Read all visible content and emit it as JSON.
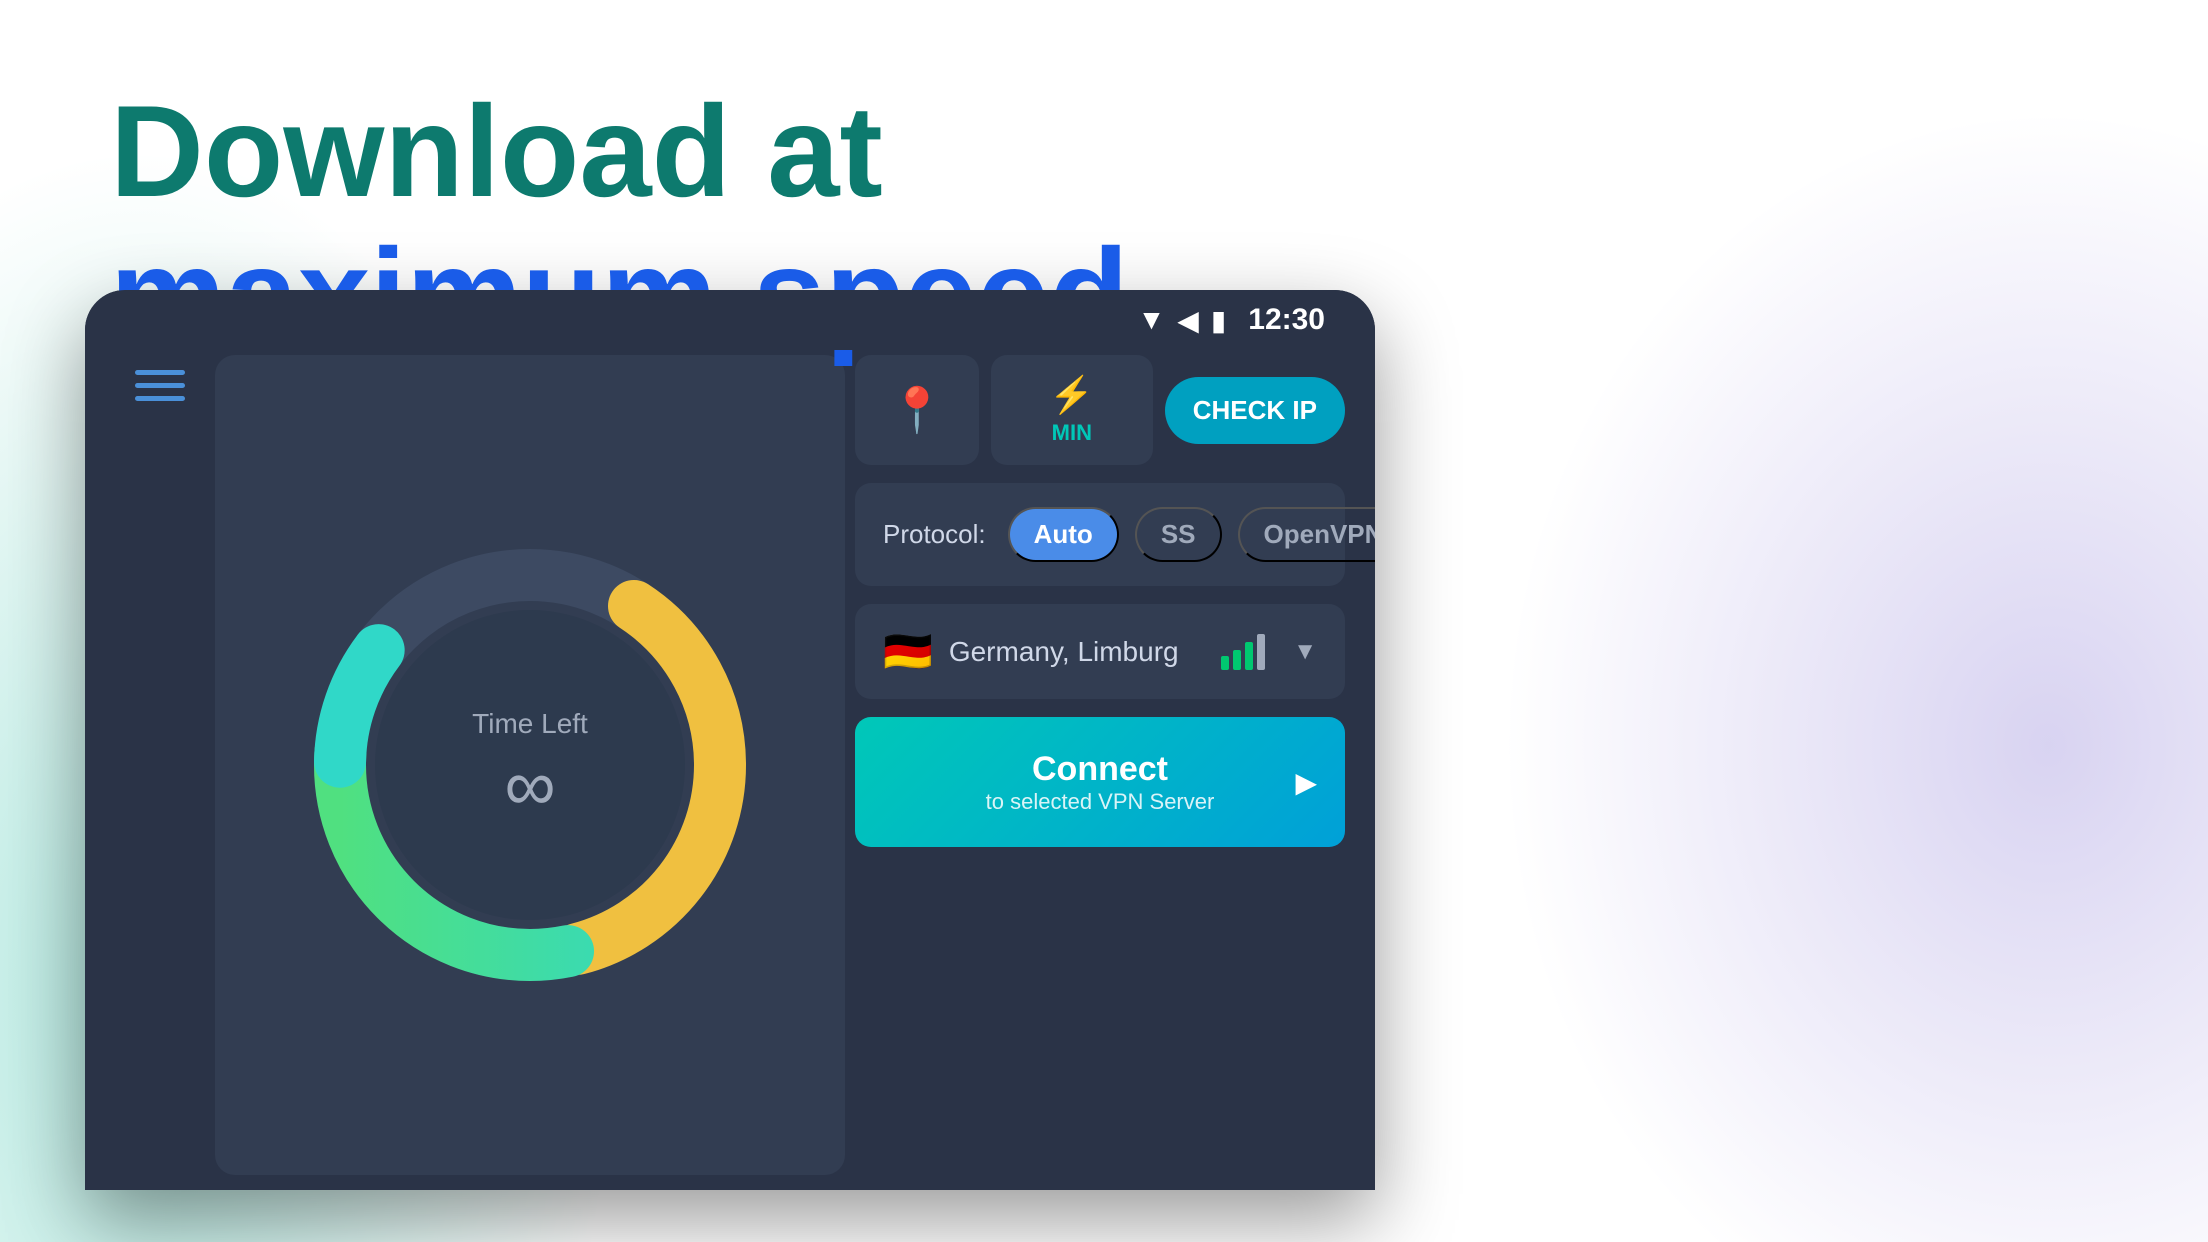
{
  "headline": {
    "line1": "Download at",
    "line2": "maximum speed"
  },
  "statusBar": {
    "time": "12:30"
  },
  "donut": {
    "timeLeftLabel": "Time Left",
    "infinitySymbol": "∞"
  },
  "topButtons": {
    "minLabel": "MIN",
    "checkIpLabel": "CHECK IP"
  },
  "protocol": {
    "label": "Protocol:",
    "options": [
      "Auto",
      "SS",
      "OpenVPN"
    ],
    "activeOption": "Auto"
  },
  "server": {
    "flag": "🇩🇪",
    "name": "Germany, Limburg"
  },
  "connect": {
    "title": "Connect",
    "subtitle": "to selected VPN Server"
  }
}
